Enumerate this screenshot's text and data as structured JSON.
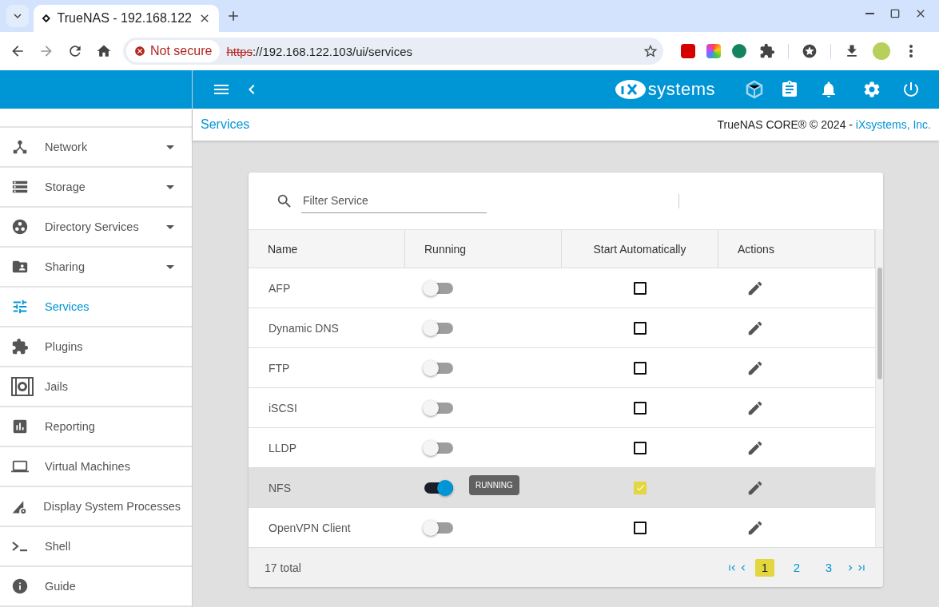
{
  "browser": {
    "tab_title": "TrueNAS - 192.168.122",
    "security": "Not secure",
    "url_scheme": "https",
    "url_rest": "://192.168.122.103/ui/services"
  },
  "header": {
    "logo_text": "systems"
  },
  "breadcrumb": "Services",
  "copyright": {
    "text": "TrueNAS CORE® © 2024 - ",
    "link": "iXsystems, Inc."
  },
  "sidebar": {
    "items": [
      {
        "label": "Network",
        "expandable": true,
        "selected": false
      },
      {
        "label": "Storage",
        "expandable": true,
        "selected": false
      },
      {
        "label": "Directory Services",
        "expandable": true,
        "selected": false
      },
      {
        "label": "Sharing",
        "expandable": true,
        "selected": false
      },
      {
        "label": "Services",
        "expandable": false,
        "selected": true
      },
      {
        "label": "Plugins",
        "expandable": false,
        "selected": false
      },
      {
        "label": "Jails",
        "expandable": false,
        "selected": false
      },
      {
        "label": "Reporting",
        "expandable": false,
        "selected": false
      },
      {
        "label": "Virtual Machines",
        "expandable": false,
        "selected": false
      },
      {
        "label": "Display System Processes",
        "expandable": false,
        "selected": false
      },
      {
        "label": "Shell",
        "expandable": false,
        "selected": false
      },
      {
        "label": "Guide",
        "expandable": false,
        "selected": false
      }
    ]
  },
  "filter": {
    "placeholder": "Filter Service"
  },
  "table": {
    "columns": [
      "Name",
      "Running",
      "Start Automatically",
      "Actions"
    ],
    "rows": [
      {
        "name": "AFP",
        "running": false,
        "auto": false,
        "highlighted": false
      },
      {
        "name": "Dynamic DNS",
        "running": false,
        "auto": false,
        "highlighted": false
      },
      {
        "name": "FTP",
        "running": false,
        "auto": false,
        "highlighted": false
      },
      {
        "name": "iSCSI",
        "running": false,
        "auto": false,
        "highlighted": false
      },
      {
        "name": "LLDP",
        "running": false,
        "auto": false,
        "highlighted": false
      },
      {
        "name": "NFS",
        "running": true,
        "auto": true,
        "highlighted": true,
        "tooltip": "RUNNING"
      },
      {
        "name": "OpenVPN Client",
        "running": false,
        "auto": false,
        "highlighted": false
      }
    ]
  },
  "footer": {
    "total": "17 total",
    "pages": [
      {
        "label": "1",
        "selected": true
      },
      {
        "label": "2",
        "selected": false
      },
      {
        "label": "3",
        "selected": false
      }
    ]
  }
}
